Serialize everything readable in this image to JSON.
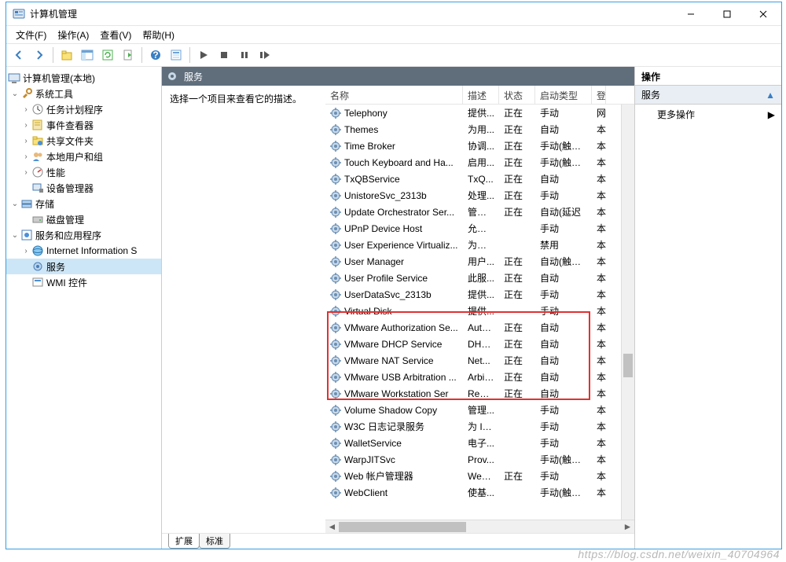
{
  "window": {
    "title": "计算机管理",
    "minimize": "–",
    "maximize": "☐",
    "close": "✕"
  },
  "menu": {
    "file": "文件(F)",
    "action": "操作(A)",
    "view": "查看(V)",
    "help": "帮助(H)"
  },
  "tree": {
    "root": "计算机管理(本地)",
    "system_tools": "系统工具",
    "task_scheduler": "任务计划程序",
    "event_viewer": "事件查看器",
    "shared_folders": "共享文件夹",
    "local_users": "本地用户和组",
    "performance": "性能",
    "device_manager": "设备管理器",
    "storage": "存储",
    "disk_mgmt": "磁盘管理",
    "services_apps": "服务和应用程序",
    "iis": "Internet Information S",
    "services": "服务",
    "wmi": "WMI 控件"
  },
  "center": {
    "header": "服务",
    "prompt": "选择一个项目来查看它的描述。",
    "columns": {
      "name": "名称",
      "desc": "描述",
      "status": "状态",
      "startup": "启动类型",
      "logon": "登"
    },
    "col_widths": {
      "name": 175,
      "desc": 46,
      "status": 46,
      "startup": 72,
      "logon": 18
    },
    "rows": [
      {
        "name": "Telephony",
        "desc": "提供...",
        "status": "正在",
        "startup": "手动",
        "logon": "网"
      },
      {
        "name": "Themes",
        "desc": "为用...",
        "status": "正在",
        "startup": "自动",
        "logon": "本"
      },
      {
        "name": "Time Broker",
        "desc": "协调...",
        "status": "正在",
        "startup": "手动(触发...",
        "logon": "本"
      },
      {
        "name": "Touch Keyboard and Ha...",
        "desc": "启用...",
        "status": "正在",
        "startup": "手动(触发...",
        "logon": "本"
      },
      {
        "name": "TxQBService",
        "desc": "TxQ...",
        "status": "正在",
        "startup": "自动",
        "logon": "本"
      },
      {
        "name": "UnistoreSvc_2313b",
        "desc": "处理...",
        "status": "正在",
        "startup": "手动",
        "logon": "本"
      },
      {
        "name": "Update Orchestrator Ser...",
        "desc": "管理 ...",
        "status": "正在",
        "startup": "自动(延迟",
        "logon": "本"
      },
      {
        "name": "UPnP Device Host",
        "desc": "允许 ...",
        "status": "",
        "startup": "手动",
        "logon": "本"
      },
      {
        "name": "User Experience Virtualiz...",
        "desc": "为应 ...",
        "status": "",
        "startup": "禁用",
        "logon": "本"
      },
      {
        "name": "User Manager",
        "desc": "用户...",
        "status": "正在",
        "startup": "自动(触发...",
        "logon": "本"
      },
      {
        "name": "User Profile Service",
        "desc": "此服...",
        "status": "正在",
        "startup": "自动",
        "logon": "本"
      },
      {
        "name": "UserDataSvc_2313b",
        "desc": "提供...",
        "status": "正在",
        "startup": "手动",
        "logon": "本"
      },
      {
        "name": "Virtual Disk",
        "desc": "提供...",
        "status": "",
        "startup": "手动",
        "logon": "本"
      },
      {
        "name": "VMware Authorization Se...",
        "desc": "Auth...",
        "status": "正在",
        "startup": "自动",
        "logon": "本",
        "hl": true
      },
      {
        "name": "VMware DHCP Service",
        "desc": "DHC...",
        "status": "正在",
        "startup": "自动",
        "logon": "本",
        "hl": true
      },
      {
        "name": "VMware NAT Service",
        "desc": "Net...",
        "status": "正在",
        "startup": "自动",
        "logon": "本",
        "hl": true
      },
      {
        "name": "VMware USB Arbitration ...",
        "desc": "Arbit...",
        "status": "正在",
        "startup": "自动",
        "logon": "本",
        "hl": true
      },
      {
        "name": "VMware Workstation Ser",
        "desc": "Rem...",
        "status": "正在",
        "startup": "自动",
        "logon": "本",
        "hl": true
      },
      {
        "name": "Volume Shadow Copy",
        "desc": "管理...",
        "status": "",
        "startup": "手动",
        "logon": "本"
      },
      {
        "name": "W3C 日志记录服务",
        "desc": "为 In...",
        "status": "",
        "startup": "手动",
        "logon": "本"
      },
      {
        "name": "WalletService",
        "desc": "电子...",
        "status": "",
        "startup": "手动",
        "logon": "本"
      },
      {
        "name": "WarpJITSvc",
        "desc": "Prov...",
        "status": "",
        "startup": "手动(触发...",
        "logon": "本"
      },
      {
        "name": "Web 帐户管理器",
        "desc": "Web...",
        "status": "正在",
        "startup": "手动",
        "logon": "本"
      },
      {
        "name": "WebClient",
        "desc": "使基...",
        "status": "",
        "startup": "手动(触发...",
        "logon": "本"
      }
    ],
    "tabs": {
      "extended": "扩展",
      "standard": "标准"
    }
  },
  "actions": {
    "header": "操作",
    "section": "服务",
    "more": "更多操作"
  },
  "watermark": "https://blog.csdn.net/weixin_40704964"
}
